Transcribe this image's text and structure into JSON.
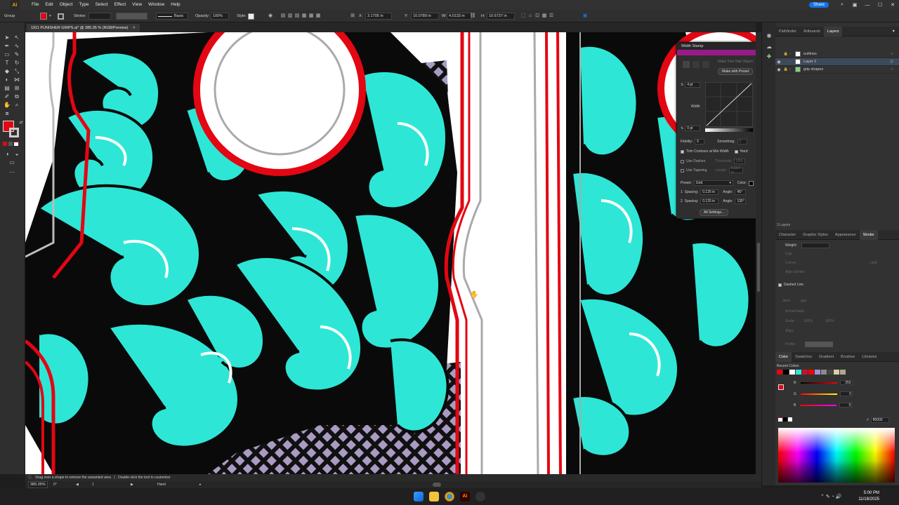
{
  "menubar": {
    "app_icon": "Ai",
    "items": [
      "File",
      "Edit",
      "Object",
      "Type",
      "Select",
      "Effect",
      "View",
      "Window",
      "Help"
    ],
    "share_label": "Share"
  },
  "control": {
    "selection_label": "Group",
    "stroke_label": "Stroke:",
    "brush_label": "Basic",
    "opacity_label": "Opacity:",
    "opacity_value": "100%",
    "style_label": "Style:",
    "x_label": "X:",
    "x_value": "3.1705 in",
    "y_label": "Y:",
    "y_value": "10.0789 in",
    "w_label": "W:",
    "w_value": "4.0133 in",
    "h_label": "H:",
    "h_value": "10.6737 in"
  },
  "document": {
    "tab_title": "1911 PUNISHER GRIPS.ai* @ 385.05 % (RGB/Preview)"
  },
  "width_stamp": {
    "title": "Width Stamp",
    "btn_trim": "Make Trim Hair Object",
    "btn_make_preset": "Make with Preset",
    "top_value": "4 pt",
    "width_label": "Width",
    "bottom_value": "0 pt",
    "fidelity_label": "Fidelity:",
    "fidelity_value": "6",
    "smoothing_label": "Smoothing:",
    "smoothing_value": "1",
    "trim_label": "Trim Contours at Min Width",
    "hard_label": "Hard",
    "use_dashes": "Use Dashes",
    "threshold_label": "Threshold:",
    "threshold_value": "20%",
    "use_tapering": "Use Tapering",
    "length_label": "Length:",
    "length_value": "0.167 in",
    "preset_label": "Preset:",
    "preset_value": "Grid",
    "color_label": "Color:",
    "spacing1_label": "Spacing:",
    "spacing1_value": "0.125 in",
    "angle1_label": "Angle:",
    "angle1_value": "45°",
    "spacing2_label": "Spacing:",
    "spacing2_value": "0.125 in",
    "angle2_label": "Angle:",
    "angle2_value": "135°",
    "row1_index": "1",
    "row2_index": "2",
    "all_settings": "All Settings..."
  },
  "layers_panel": {
    "tabs": [
      "Pathfinder",
      "Artboards",
      "Layers"
    ],
    "layers": [
      {
        "name": "outlines"
      },
      {
        "name": "Layer 2"
      },
      {
        "name": "grip shapes"
      }
    ],
    "count_label": "3 Layers"
  },
  "stroke_panel": {
    "tabs": [
      "Character",
      "Graphic Styles",
      "Appearance",
      "Stroke"
    ],
    "weight_label": "Weight:",
    "cap_label": "Cap:",
    "corner_label": "Corner:",
    "limit_label": "Limit:",
    "align_label": "Align Stroke:",
    "dashed_line_label": "Dashed Line",
    "dash_label": "dash",
    "gap_label": "gap",
    "arrowheads_label": "Arrowheads:",
    "scale_label": "Scale:",
    "scale_value1": "100%",
    "scale_value2": "100%",
    "align_arrow_label": "Align:",
    "profile_label": "Profile:"
  },
  "color_panel": {
    "tabs": [
      "Color",
      "Swatches",
      "Gradient",
      "Brushes",
      "Libraries"
    ],
    "recent_label": "Recent Colors",
    "r_label": "R",
    "r_value": "255",
    "g_label": "G",
    "g_value": "0",
    "b_label": "B",
    "b_value": "0",
    "hex_value": "ff0000",
    "recent_colors": [
      "#e30613",
      "#000000",
      "#ffffff",
      "#2ee6d6",
      "#c8102e",
      "#ff0000",
      "#a68fd0",
      "#8b8b8b",
      "#444444",
      "#d8cfa0",
      "#b0a890"
    ]
  },
  "status": {
    "hint": "Drag over a shape to remove the unwanted area",
    "hint2": "Double-click the tool to customize",
    "zoom": "385.05%",
    "angle": "0°",
    "artboard": "1",
    "tool": "Hand"
  },
  "taskbar": {
    "time": "5:00 PM",
    "date": "11/18/2025"
  },
  "colors": {
    "teal": "#2ee6d6",
    "red": "#e30613",
    "lavender": "#a99bc4",
    "accent": "#1473e6"
  }
}
